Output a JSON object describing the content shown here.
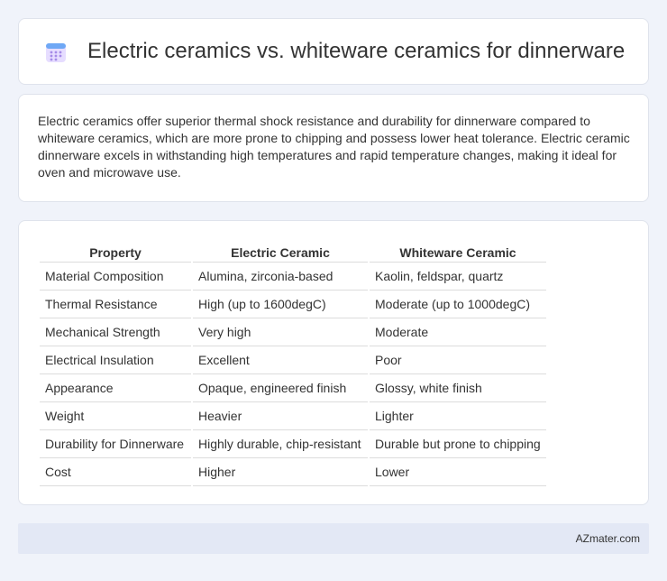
{
  "header": {
    "icon": "calendar-icon",
    "title": "Electric ceramics vs. whiteware ceramics for dinnerware"
  },
  "summary": {
    "text": "Electric ceramics offer superior thermal shock resistance and durability for dinnerware compared to whiteware ceramics, which are more prone to chipping and possess lower heat tolerance. Electric ceramic dinnerware excels in withstanding high temperatures and rapid temperature changes, making it ideal for oven and microwave use."
  },
  "table": {
    "headers": [
      "Property",
      "Electric Ceramic",
      "Whiteware Ceramic"
    ],
    "rows": [
      [
        "Material Composition",
        "Alumina, zirconia-based",
        "Kaolin, feldspar, quartz"
      ],
      [
        "Thermal Resistance",
        "High (up to 1600degC)",
        "Moderate (up to 1000degC)"
      ],
      [
        "Mechanical Strength",
        "Very high",
        "Moderate"
      ],
      [
        "Electrical Insulation",
        "Excellent",
        "Poor"
      ],
      [
        "Appearance",
        "Opaque, engineered finish",
        "Glossy, white finish"
      ],
      [
        "Weight",
        "Heavier",
        "Lighter"
      ],
      [
        "Durability for Dinnerware",
        "Highly durable, chip-resistant",
        "Durable but prone to chipping"
      ],
      [
        "Cost",
        "Higher",
        "Lower"
      ]
    ]
  },
  "footer": {
    "brand": "AZmater.com"
  }
}
